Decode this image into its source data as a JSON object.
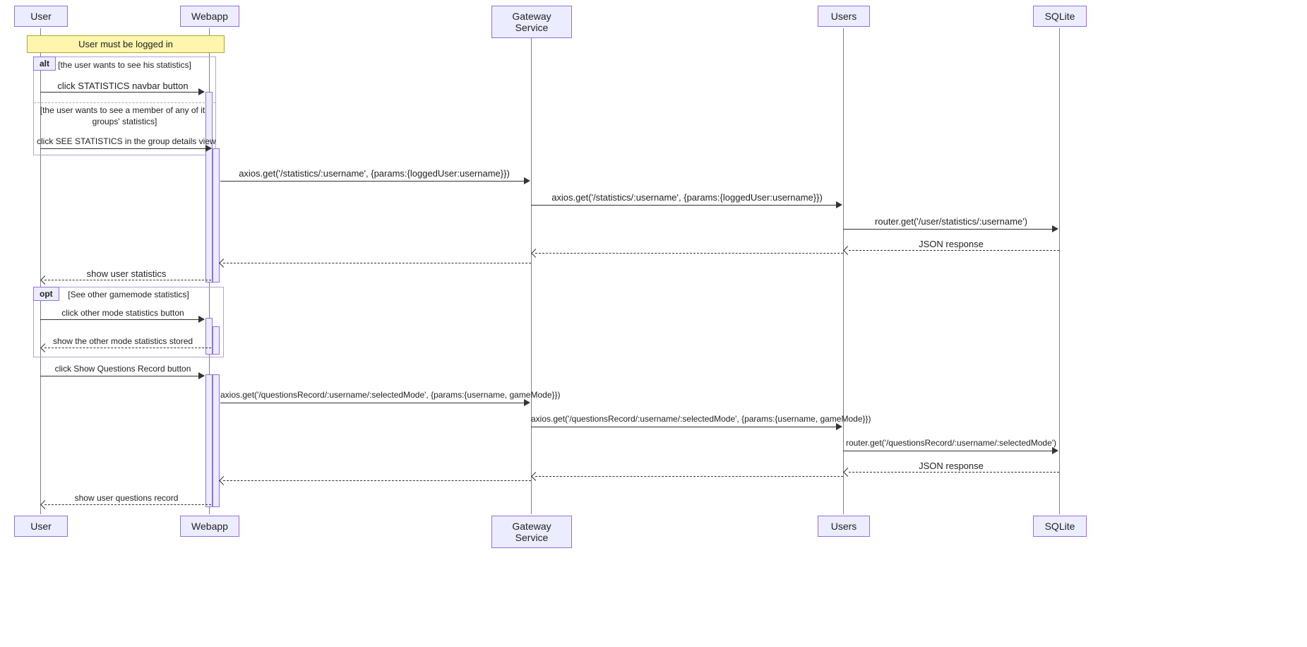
{
  "actors": {
    "user": "User",
    "webapp": "Webapp",
    "gateway": "Gateway Service",
    "users": "Users",
    "sqlite": "SQLite"
  },
  "note_login": "User must be logged in",
  "frag_alt": {
    "label": "alt",
    "guard1": "[the user wants to see his statistics]",
    "guard2": "[the user wants to see a member of any of its groups' statistics]"
  },
  "frag_opt": {
    "label": "opt",
    "guard": "[See other gamemode statistics]"
  },
  "messages": {
    "m1": "click STATISTICS navbar button",
    "m2": "click SEE STATISTICS in the group details view",
    "m3": "axios.get('/statistics/:username', {params:{loggedUser:username}})",
    "m4": "axios.get('/statistics/:username', {params:{loggedUser:username}})",
    "m5": "router.get('/user/statistics/:username')",
    "m6": "JSON response",
    "m7": "show user statistics",
    "m8": "click other mode statistics button",
    "m9": "show the other mode statistics stored",
    "m10": "click Show Questions Record button",
    "m11": "axios.get('/questionsRecord/:username/:selectedMode', {params:{username, gameMode}})",
    "m12": "axios.get('/questionsRecord/:username/:selectedMode', {params:{username, gameMode}})",
    "m13": "router.get('/questionsRecord/:username/:selectedMode')",
    "m14": "JSON response",
    "m15": "show user questions record"
  }
}
